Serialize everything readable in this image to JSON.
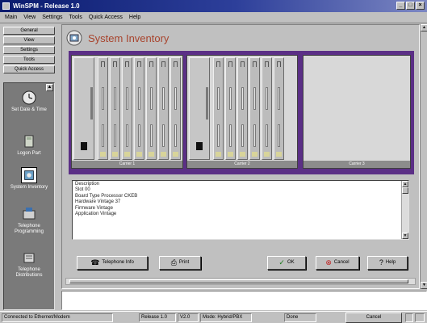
{
  "window": {
    "title": "WinSPM - Release 1.0"
  },
  "menubar": {
    "items": [
      "Main",
      "View",
      "Settings",
      "Tools",
      "Quick Access",
      "Help"
    ]
  },
  "leftnav": {
    "buttons": [
      "General",
      "View",
      "Settings",
      "Tools",
      "Quick Access"
    ],
    "items": [
      {
        "label": "Set Date & Time",
        "icon": "clock-icon"
      },
      {
        "label": "Logon Part",
        "icon": "telephone-icon"
      },
      {
        "label": "System Inventory",
        "icon": "inventory-icon"
      },
      {
        "label": "Telephone Programming",
        "icon": "telephone-programming-icon"
      },
      {
        "label": "Telephone Distributions",
        "icon": "distribution-icon"
      }
    ]
  },
  "main": {
    "title": "System Inventory",
    "carriers": [
      {
        "label": "Carrier 1"
      },
      {
        "label": "Carrier 2"
      },
      {
        "label": "Carrier 3"
      }
    ],
    "description": {
      "lines": [
        "Description",
        "Slot 00",
        "Board Type Processor CKEB",
        "Hardware Vintage 37",
        "Firmware Vintage",
        "Application Vintage"
      ]
    },
    "buttons": {
      "telephone_info": "Telephone Info",
      "print": "Print",
      "ok": "OK",
      "cancel": "Cancel",
      "help": "Help"
    }
  },
  "statusbar": {
    "connection": "Connected to Ethernet/Modem",
    "release": "Release 1.0",
    "vintage": "V2.0",
    "mode": "Mode: Hybrid/PBX",
    "state": "Done",
    "cancel": "Cancel"
  }
}
